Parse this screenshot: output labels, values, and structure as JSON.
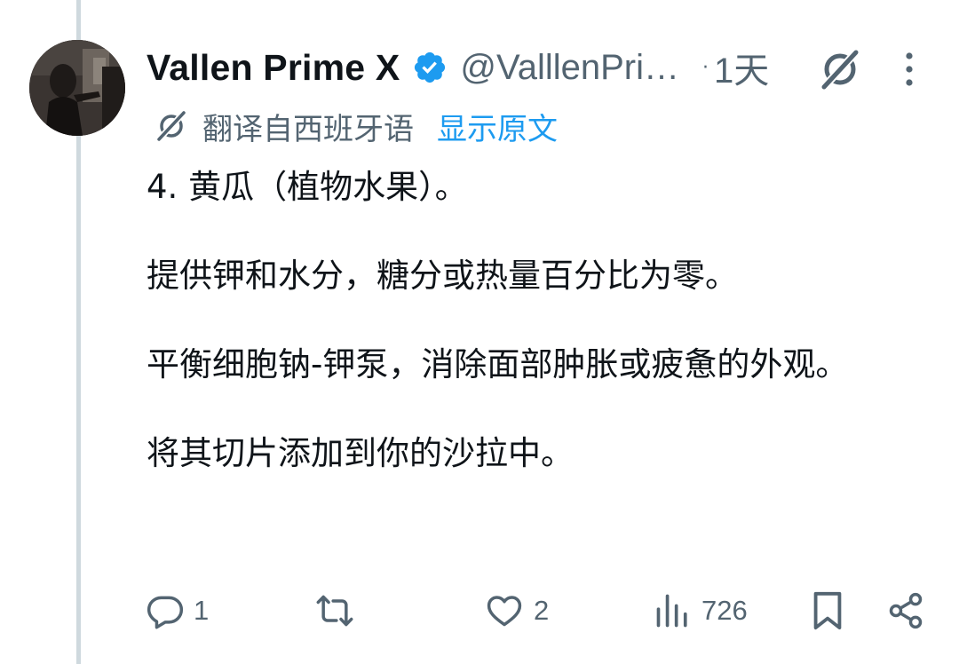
{
  "tweet": {
    "display_name": "Vallen Prime X",
    "handle": "@ValllenPri…",
    "separator": "·",
    "time": "1天",
    "translation": {
      "label": "翻译自西班牙语",
      "show_original": "显示原文"
    },
    "paragraphs": [
      "4. 黄瓜（植物水果）。",
      "提供钾和水分，糖分或热量百分比为零。",
      "平衡细胞钠-钾泵，消除面部肿胀或疲惫的外观。",
      "将其切片添加到你的沙拉中。"
    ],
    "actions": {
      "replies": "1",
      "reposts": "",
      "likes": "2",
      "views": "726"
    }
  },
  "icons": {
    "verified": "verified-badge-icon",
    "grok": "grok-icon",
    "more": "more-icon",
    "translate": "translate-icon",
    "reply": "reply-icon",
    "repost": "repost-icon",
    "like": "like-icon",
    "views": "views-icon",
    "bookmark": "bookmark-icon",
    "share": "share-icon"
  },
  "colors": {
    "text_primary": "#0f1419",
    "text_secondary": "#536471",
    "accent": "#1d9bf0",
    "thread_line": "#cfd9de"
  }
}
